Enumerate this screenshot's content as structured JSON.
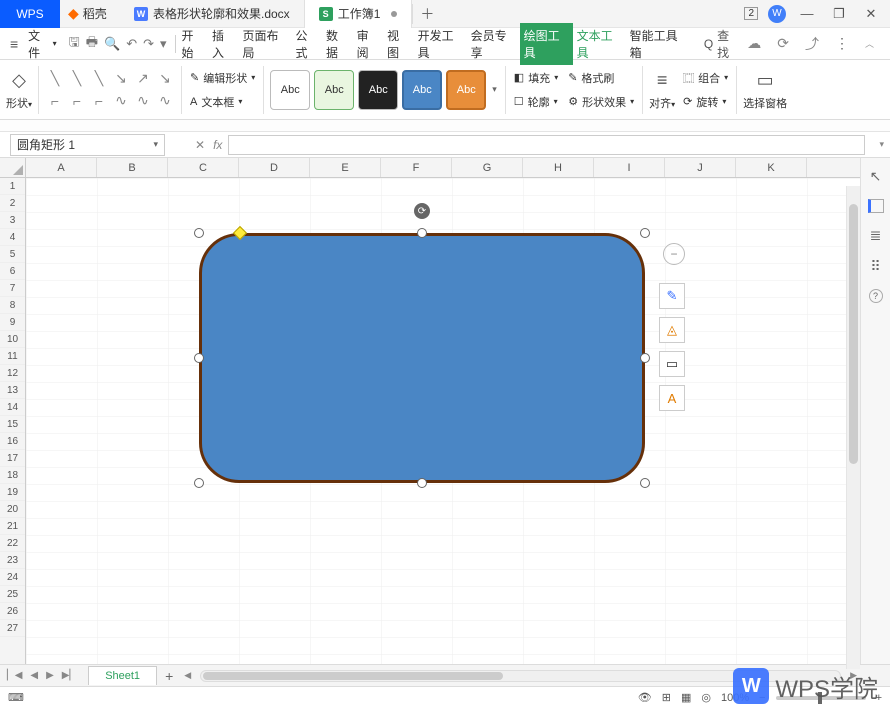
{
  "titlebar": {
    "logo": "WPS",
    "dk_label": "稻壳",
    "doc_tab_label": "表格形状轮廓和效果.docx",
    "sheet_tab_label": "工作簿1",
    "badge_number": "2",
    "min": "—",
    "restore": "❐",
    "close": "✕",
    "plus": "＋"
  },
  "menubar": {
    "file": "文件",
    "tabs": [
      "开始",
      "插入",
      "页面布局",
      "公式",
      "数据",
      "审阅",
      "视图",
      "开发工具",
      "会员专享",
      "绘图工具",
      "文本工具",
      "智能工具箱"
    ],
    "active_index": 9,
    "texttool_index": 10,
    "search": "查找"
  },
  "ribbon": {
    "shape_btn": "形状",
    "edit_shape": "编辑形状",
    "textbox": "文本框",
    "preset_label": "Abc",
    "fill": "填充",
    "outline": "轮廓",
    "format_painter": "格式刷",
    "shape_effects": "形状效果",
    "align": "对齐",
    "group": "组合",
    "rotate": "旋转",
    "selection_pane": "选择窗格"
  },
  "formula_row": {
    "namebox": "圆角矩形  1",
    "fx": "fx"
  },
  "columns": [
    "A",
    "B",
    "C",
    "D",
    "E",
    "F",
    "G",
    "H",
    "I",
    "J",
    "K"
  ],
  "rows": [
    "1",
    "2",
    "3",
    "4",
    "5",
    "6",
    "7",
    "8",
    "9",
    "10",
    "11",
    "12",
    "13",
    "14",
    "15",
    "16",
    "17",
    "18",
    "19",
    "20",
    "21",
    "22",
    "23",
    "24",
    "25",
    "26",
    "27"
  ],
  "sheetbar": {
    "sheet_name": "Sheet1"
  },
  "statusbar": {
    "zoom": "100%"
  },
  "watermark": {
    "label": "WPS学院",
    "icon": "W"
  },
  "icons": {
    "fire": "▲",
    "w": "W",
    "s": "S",
    "circle_w": "W",
    "caret": "﹀",
    "caretUp": "︿",
    "caretSmall": "▾",
    "save": "🖫",
    "print": "🖶",
    "preview": "🔍",
    "undo": "↶",
    "redo": "↷",
    "cloud": "☁",
    "collab": "⟳",
    "share": "⤴",
    "dots": "⋮",
    "shape_main": "◇",
    "search": "Q",
    "fill_i": "◧",
    "outline_i": "☐",
    "fp_i": "✎",
    "fx_i": "⚙",
    "align_i": "≡",
    "group_i": "⿴",
    "rotate_i": "⟳",
    "pane_i": "▭",
    "eye": "👁",
    "grid": "⊞",
    "book": "▦",
    "cam": "◎",
    "minus": "−",
    "plus": "+",
    "cursor": "↖",
    "bars": "≣",
    "gear": "⠿",
    "q": "?",
    "pen": "✎",
    "bucket": "◬",
    "rect": "▭",
    "Aa": "A",
    "rot": "⟳",
    "hmenu": "≡",
    "adjust": "◆",
    "nav_first": "▏◀",
    "nav_prev": "◀",
    "nav_next": "▶",
    "nav_last": "▶▏",
    "kb": "⌨"
  }
}
